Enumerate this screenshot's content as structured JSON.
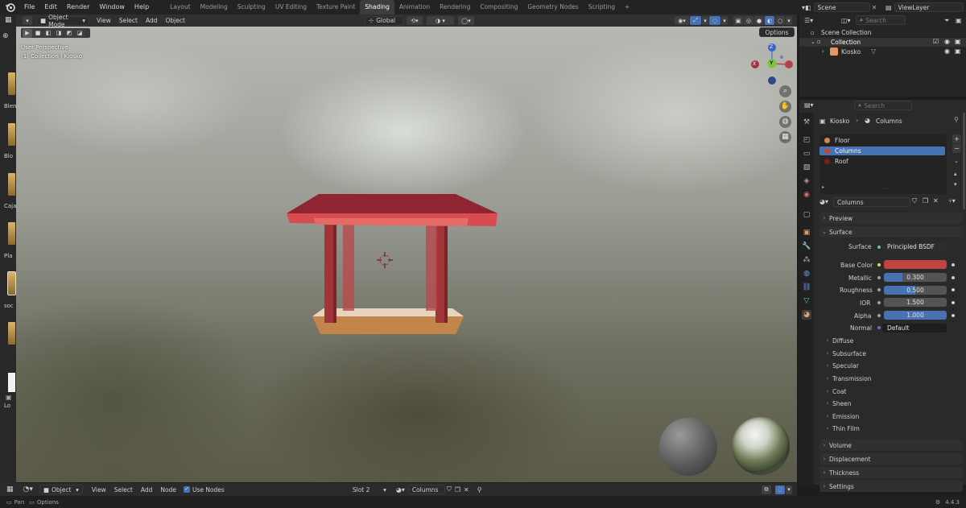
{
  "topbar": {
    "menus": [
      "File",
      "Edit",
      "Render",
      "Window",
      "Help"
    ],
    "workspaces": [
      "Layout",
      "Modeling",
      "Sculpting",
      "UV Editing",
      "Texture Paint",
      "Shading",
      "Animation",
      "Rendering",
      "Compositing",
      "Geometry Nodes",
      "Scripting"
    ],
    "active_workspace": "Shading",
    "add_tab": "+",
    "scene": "Scene",
    "view_layer": "ViewLayer"
  },
  "viewport_header": {
    "mode": "Object Mode",
    "menus": [
      "View",
      "Select",
      "Add",
      "Object"
    ],
    "transform": "Global",
    "options": "Options"
  },
  "viewport": {
    "overlay_line1": "User Perspective",
    "overlay_line2": "(1) Collection | Kiosko",
    "gizmo": {
      "z": "Z",
      "y": "Y",
      "x": "X"
    }
  },
  "left_strip": {
    "labels": [
      "Blen",
      "Blo",
      "Caja",
      "Pla",
      "soc",
      "Lo"
    ]
  },
  "outliner": {
    "search_placeholder": "Search",
    "scene_collection": "Scene Collection",
    "collection": "Collection",
    "object": "Kiosko"
  },
  "properties": {
    "search_placeholder": "Search",
    "breadcrumb_object": "Kiosko",
    "breadcrumb_material": "Columns",
    "slots": [
      "Floor",
      "Columns",
      "Roof"
    ],
    "active_slot": "Columns",
    "material_name": "Columns",
    "preview": "Preview",
    "surface": "Surface",
    "surface_label": "Surface",
    "surface_value": "Principled BSDF",
    "base_color_label": "Base Color",
    "base_color": "#c0453f",
    "metallic_label": "Metallic",
    "metallic": "0.300",
    "metallic_fill": 0.3,
    "roughness_label": "Roughness",
    "roughness": "0.500",
    "roughness_fill": 0.5,
    "ior_label": "IOR",
    "ior": "1.500",
    "alpha_label": "Alpha",
    "alpha": "1.000",
    "alpha_fill": 1.0,
    "normal_label": "Normal",
    "normal": "Default",
    "subsections": [
      "Diffuse",
      "Subsurface",
      "Specular",
      "Transmission",
      "Coat",
      "Sheen",
      "Emission",
      "Thin Film"
    ],
    "bottom_sections": [
      "Volume",
      "Displacement",
      "Thickness",
      "Settings"
    ]
  },
  "shader_header": {
    "editor": "Object",
    "menus": [
      "View",
      "Select",
      "Add",
      "Node"
    ],
    "use_nodes": "Use Nodes",
    "slot": "Slot 2",
    "material": "Columns"
  },
  "statusbar": {
    "pan": "Pan",
    "options": "Options",
    "version": "4.4.3"
  },
  "colors": {
    "accent_blue": "#4772b3",
    "roof": "#a8323a",
    "column": "#b0383c",
    "floor": "#c98f4e"
  }
}
